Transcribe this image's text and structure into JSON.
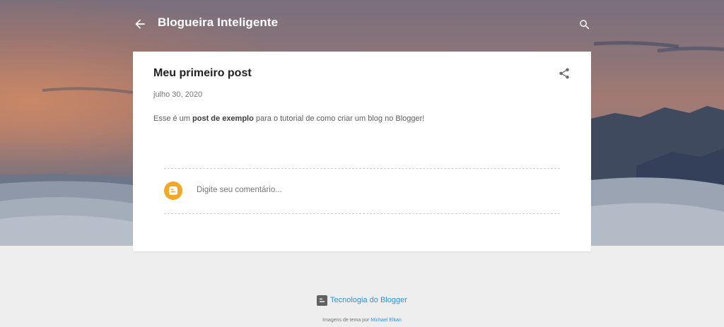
{
  "header": {
    "blog_title": "Blogueira Inteligente",
    "back_icon": "arrow-left-icon",
    "search_icon": "search-icon"
  },
  "post": {
    "title": "Meu primeiro post",
    "date": "julho 30, 2020",
    "body_prefix": "Esse é um ",
    "body_bold": "post de exemplo",
    "body_suffix": " para o tutorial de como criar um blog no Blogger!",
    "share_icon": "share-icon"
  },
  "comments": {
    "placeholder": "Digite seu comentário...",
    "avatar_icon": "blogger-icon"
  },
  "footer": {
    "powered_by": "Tecnologia do Blogger",
    "attribution_prefix": "Imagens de tema por",
    "attribution_author": "Michael Elkan"
  },
  "colors": {
    "accent_link": "#2196f3",
    "blogger_orange": "#f5a623",
    "page_background": "#eeeeee"
  }
}
